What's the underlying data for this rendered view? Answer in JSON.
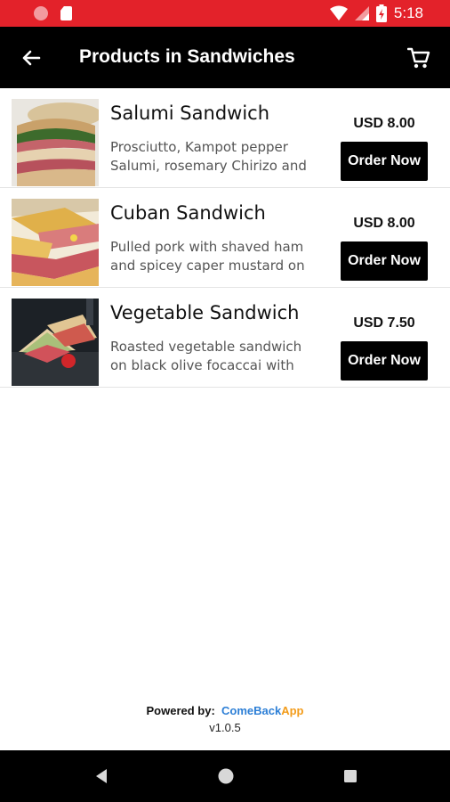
{
  "status_bar": {
    "time": "5:18",
    "bar_color": "#e3222a"
  },
  "app_bar": {
    "title": "Products in Sandwiches",
    "back_icon": "arrow-left-icon",
    "cart_icon": "shopping-cart-icon"
  },
  "products": [
    {
      "name": "Salumi Sandwich",
      "description": "Prosciutto, Kampot pepper Salumi, rosemary Chirizo and",
      "price": "USD 8.00",
      "order_label": "Order Now"
    },
    {
      "name": "Cuban Sandwich",
      "description": "Pulled pork with shaved ham and spicey caper mustard on",
      "price": "USD 8.00",
      "order_label": "Order Now"
    },
    {
      "name": "Vegetable Sandwich",
      "description": "Roasted vegetable sandwich on black olive focaccai with",
      "price": "USD 7.50",
      "order_label": "Order Now"
    }
  ],
  "footer": {
    "powered_label": "Powered by:",
    "brand_part1": "Come",
    "brand_part2": "Back",
    "brand_part3": "App",
    "version": "v1.0.5"
  },
  "colors": {
    "brand_blue": "#2d7fd6",
    "brand_orange": "#f39c1a",
    "button_bg": "#000000"
  }
}
